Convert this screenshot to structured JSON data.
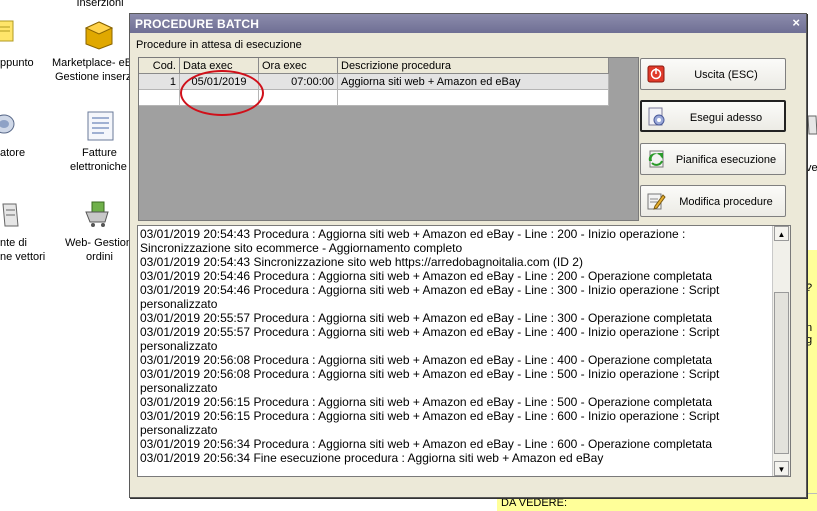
{
  "desktop": {
    "icons": [
      {
        "name": "inserzioni",
        "label1": "Inserzioni",
        "label2": ""
      },
      {
        "name": "appunto",
        "label1": "ppunto",
        "label2": ""
      },
      {
        "name": "marketplace",
        "label1": "Marketplace- eB",
        "label2": "Gestione inserz"
      },
      {
        "name": "atore",
        "label1": "atore",
        "label2": ""
      },
      {
        "name": "fatture",
        "label1": "Fatture",
        "label2": "elettroniche"
      },
      {
        "name": "vettori",
        "label1": "nte di",
        "label2": "ne vettori"
      },
      {
        "name": "webgestion",
        "label1": "Web- Gestion",
        "label2": "ordini"
      }
    ],
    "side_fragments": [
      "?",
      "n g",
      "ve"
    ],
    "bottom_text": "DA VEDERE:"
  },
  "dialog": {
    "title": "PROCEDURE BATCH",
    "close_glyph": "×",
    "subtitle": "Procedure in attesa di esecuzione",
    "grid": {
      "headers": [
        "Cod.",
        "Data exec",
        "Ora exec",
        "Descrizione procedura"
      ],
      "rows": [
        {
          "cod": "1",
          "date": "05/01/2019",
          "time": "07:00:00",
          "desc": "Aggiorna siti web + Amazon ed eBay"
        }
      ]
    },
    "buttons": [
      {
        "label": "Uscita (ESC)",
        "icon": "exit-icon"
      },
      {
        "label": "Esegui adesso",
        "icon": "run-now-icon"
      },
      {
        "label": "Pianifica esecuzione",
        "icon": "schedule-icon"
      },
      {
        "label": "Modifica procedure",
        "icon": "edit-icon"
      }
    ],
    "log_lines": [
      "03/01/2019 20:54:43 Procedura : Aggiorna siti web + Amazon ed eBay - Line : 200 - Inizio operazione :",
      "Sincronizzazione sito ecommerce - Aggiornamento completo",
      "03/01/2019 20:54:43 Sincronizzazione sito web https://arredobagnoitalia.com (ID 2)",
      "03/01/2019 20:54:46 Procedura : Aggiorna siti web + Amazon ed eBay - Line : 200 - Operazione completata",
      "03/01/2019 20:54:46 Procedura : Aggiorna siti web + Amazon ed eBay - Line : 300 - Inizio operazione : Script",
      "personalizzato",
      "03/01/2019 20:55:57 Procedura : Aggiorna siti web + Amazon ed eBay - Line : 300 - Operazione completata",
      "03/01/2019 20:55:57 Procedura : Aggiorna siti web + Amazon ed eBay - Line : 400 - Inizio operazione : Script",
      "personalizzato",
      "03/01/2019 20:56:08 Procedura : Aggiorna siti web + Amazon ed eBay - Line : 400 - Operazione completata",
      "03/01/2019 20:56:08 Procedura : Aggiorna siti web + Amazon ed eBay - Line : 500 - Inizio operazione : Script",
      "personalizzato",
      "03/01/2019 20:56:15 Procedura : Aggiorna siti web + Amazon ed eBay - Line : 500 - Operazione completata",
      "03/01/2019 20:56:15 Procedura : Aggiorna siti web + Amazon ed eBay - Line : 600 - Inizio operazione : Script",
      "personalizzato",
      "03/01/2019 20:56:34 Procedura : Aggiorna siti web + Amazon ed eBay - Line : 600 - Operazione completata",
      "03/01/2019 20:56:34 Fine esecuzione procedura : Aggiorna siti web + Amazon ed eBay"
    ],
    "scroll_up": "▲",
    "scroll_down": "▼"
  },
  "colors": {
    "dialog_bg": "#ece9d8",
    "titlebar": "#7c7ca0",
    "annotation_circle": "#d0101a",
    "yellow_panel": "#ffff99"
  }
}
